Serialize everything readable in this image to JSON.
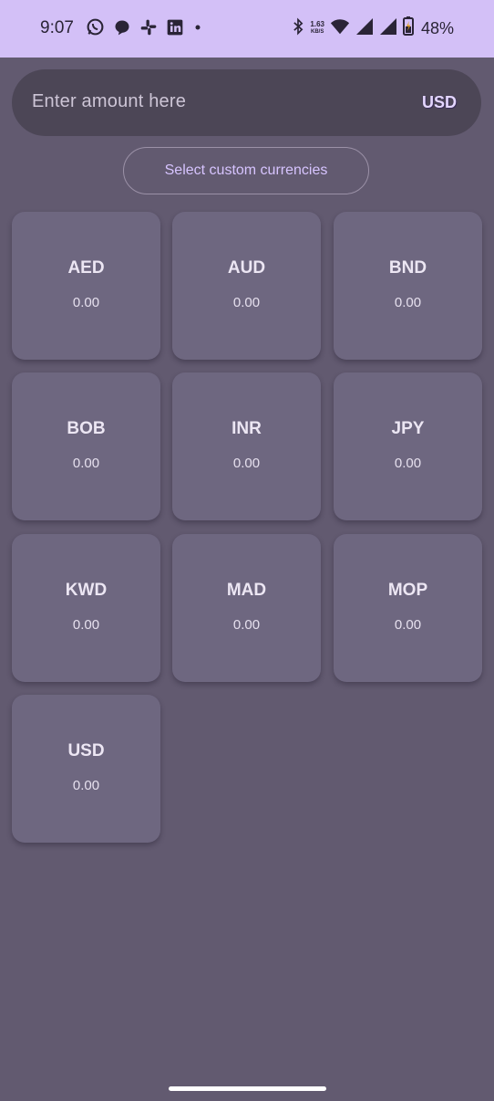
{
  "status_bar": {
    "time": "9:07",
    "left_icons": [
      "whatsapp-icon",
      "chat-bubble-icon",
      "slack-icon",
      "linkedin-icon",
      "dot-icon"
    ],
    "net_speed_value": "1.63",
    "net_speed_unit": "KB/S",
    "battery_percent": "48%"
  },
  "amount_input": {
    "placeholder": "Enter amount here",
    "currency": "USD"
  },
  "custom_currencies_button": {
    "label": "Select custom currencies"
  },
  "currencies": [
    {
      "code": "AED",
      "value": "0.00"
    },
    {
      "code": "AUD",
      "value": "0.00"
    },
    {
      "code": "BND",
      "value": "0.00"
    },
    {
      "code": "BOB",
      "value": "0.00"
    },
    {
      "code": "INR",
      "value": "0.00"
    },
    {
      "code": "JPY",
      "value": "0.00"
    },
    {
      "code": "KWD",
      "value": "0.00"
    },
    {
      "code": "MAD",
      "value": "0.00"
    },
    {
      "code": "MOP",
      "value": "0.00"
    },
    {
      "code": "USD",
      "value": "0.00"
    }
  ],
  "colors": {
    "status_bar_bg": "#d3c0f7",
    "background": "#625a70",
    "card_bg": "#6e6780",
    "accent": "#d7c4ff"
  }
}
